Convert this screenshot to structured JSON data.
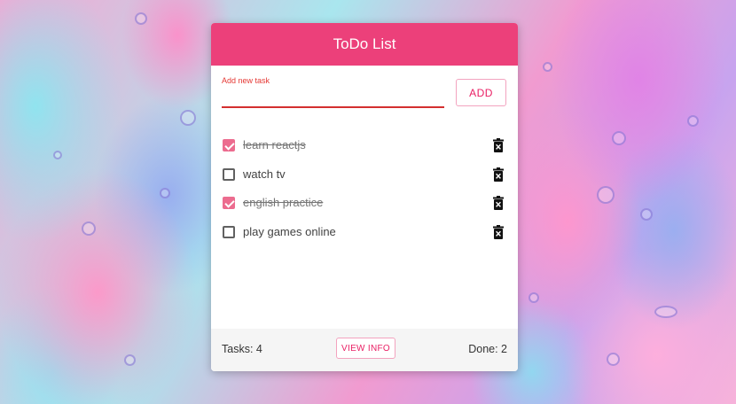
{
  "header": {
    "title": "ToDo List"
  },
  "new_task": {
    "label": "Add new task",
    "value": "",
    "add_label": "ADD"
  },
  "tasks": [
    {
      "text": "learn reactjs",
      "done": true
    },
    {
      "text": "watch tv",
      "done": false
    },
    {
      "text": "english practice",
      "done": true
    },
    {
      "text": "play games online",
      "done": false
    }
  ],
  "footer": {
    "tasks_label": "Tasks: 4",
    "view_info_label": "VIEW INFO",
    "done_label": "Done: 2"
  },
  "icons": {
    "delete": "trash-x-icon",
    "check": "checkbox-icon"
  },
  "colors": {
    "accent": "#ec407a",
    "checked": "#ec6c8f",
    "error_underline": "#d32f2f"
  }
}
